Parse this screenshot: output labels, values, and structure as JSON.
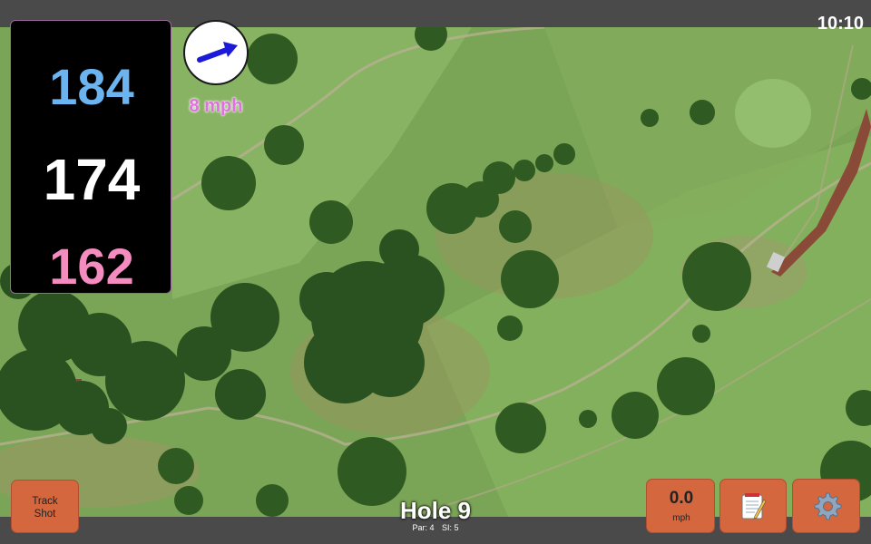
{
  "status": {
    "clock": "10:10"
  },
  "distances": {
    "back": "184",
    "middle": "174",
    "front": "162"
  },
  "wind": {
    "speed": "8 mph",
    "direction_icon": "arrow-icon"
  },
  "hole": {
    "title": "Hole 9",
    "par": "Par: 4",
    "stroke_index": "SI: 5"
  },
  "buttons": {
    "track_shot_line1": "Track",
    "track_shot_line2": "Shot",
    "speed_value": "0.0",
    "speed_unit": "mph",
    "notes_icon": "notepad-icon",
    "settings_icon": "gear-icon"
  },
  "colors": {
    "back": "#6cb4f0",
    "middle": "#ffffff",
    "front": "#f48cc0",
    "wind_text": "#e070e0",
    "button": "#d4673e",
    "arrow": "#1a1ad8"
  }
}
